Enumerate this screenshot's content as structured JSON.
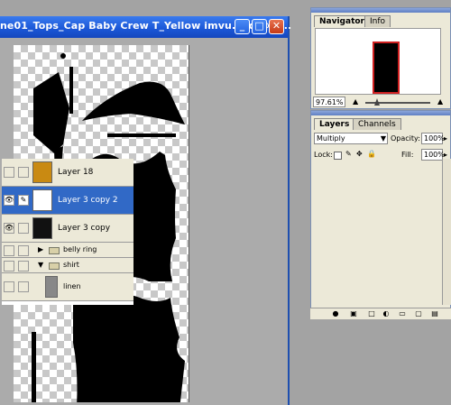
{
  "document": {
    "title": "ne01_Tops_Cap Baby Crew T_Yellow imvu.psd @ 9..."
  },
  "navigator": {
    "tabs": [
      "Navigator",
      "Info"
    ],
    "zoom": "97.61%"
  },
  "layers_panel": {
    "tabs": [
      "Layers",
      "Channels"
    ],
    "blend_mode": "Multiply",
    "opacity_label": "Opacity:",
    "opacity": "100%",
    "lock_label": "Lock:",
    "fill_label": "Fill:",
    "fill": "100%",
    "layers": [
      {
        "name": "Layer 18",
        "visible": false,
        "selected": false
      },
      {
        "name": "Layer 3 copy 2",
        "visible": true,
        "selected": true
      },
      {
        "name": "Layer 3 copy",
        "visible": true,
        "selected": false
      },
      {
        "name": "belly ring",
        "visible": false,
        "selected": false
      },
      {
        "name": "shirt",
        "visible": false,
        "selected": false
      },
      {
        "name": "linen",
        "visible": false,
        "selected": false
      }
    ]
  },
  "icons": {
    "window_controls": [
      "minimize-icon",
      "maximize-icon",
      "close-icon"
    ],
    "eye": "👁",
    "brush": "✎",
    "folder": "folder-icon"
  },
  "colors": {
    "titlebar": "#1a56d6",
    "selected_layer": "#3169c6",
    "layer18_thumb": "#c98a12"
  }
}
